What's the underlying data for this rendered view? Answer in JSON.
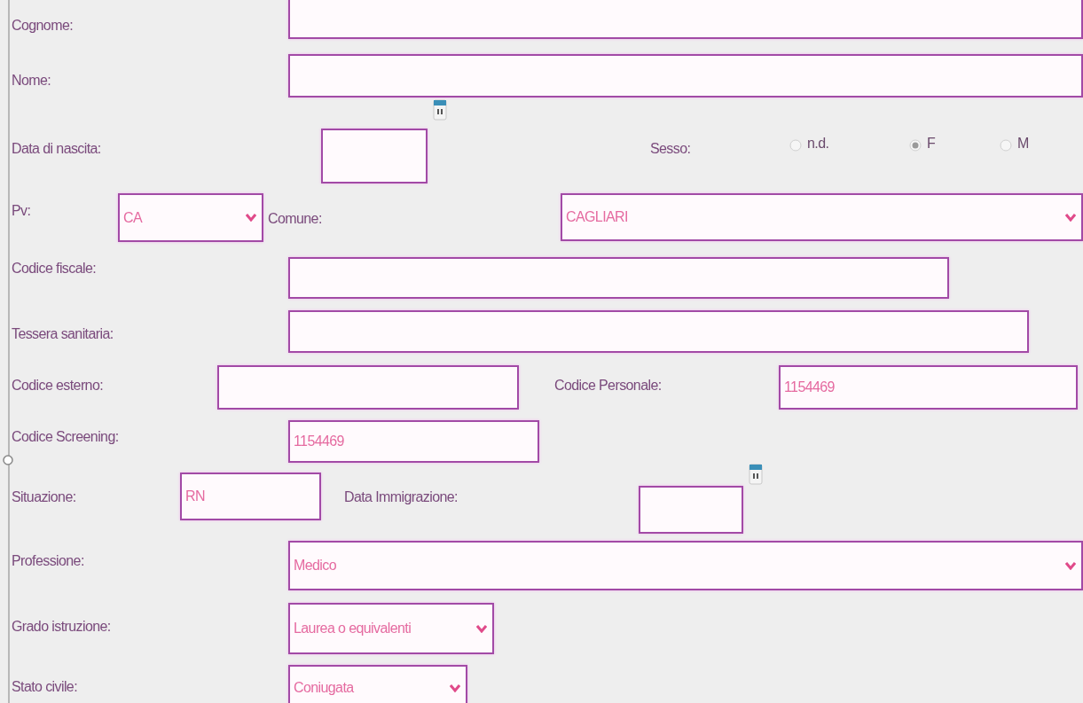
{
  "rows": [
    {
      "items": [
        {
          "kind": "label",
          "text": "Cognome:"
        },
        {
          "kind": "text"
        }
      ]
    },
    {
      "items": [
        {
          "kind": "label",
          "text": "Nome:"
        },
        {
          "kind": "text"
        }
      ]
    },
    {
      "items": [
        {
          "kind": "label",
          "text": "Data di nascita:"
        },
        {
          "kind": "date"
        },
        {
          "kind": "label",
          "text": "Sesso:"
        },
        {
          "kind": "radio",
          "label": "n.d.",
          "selected": false
        },
        {
          "kind": "radio",
          "label": "F",
          "selected": true
        },
        {
          "kind": "radio",
          "label": "M",
          "selected": false
        }
      ]
    },
    {
      "items": [
        {
          "kind": "label",
          "text": "Pv:"
        },
        {
          "kind": "select",
          "value": "CA"
        },
        {
          "kind": "label",
          "text": "Comune:"
        },
        {
          "kind": "select",
          "value": "CAGLIARI"
        }
      ]
    },
    {
      "items": [
        {
          "kind": "label",
          "text": "Codice fiscale:"
        },
        {
          "kind": "text"
        }
      ]
    },
    {
      "items": [
        {
          "kind": "label",
          "text": "Tessera sanitaria:"
        },
        {
          "kind": "text"
        }
      ]
    },
    {
      "items": [
        {
          "kind": "label",
          "text": "Codice esterno:"
        },
        {
          "kind": "text"
        },
        {
          "kind": "label",
          "text": "Codice Personale:"
        },
        {
          "kind": "text",
          "value": "1154469"
        }
      ]
    },
    {
      "items": [
        {
          "kind": "label",
          "text": "Codice Screening:"
        },
        {
          "kind": "text",
          "value": "1154469"
        }
      ]
    },
    {
      "items": [
        {
          "kind": "label",
          "text": "Situazione:"
        },
        {
          "kind": "text",
          "value": "RN"
        },
        {
          "kind": "label",
          "text": "Data Immigrazione:"
        },
        {
          "kind": "date"
        }
      ]
    },
    {
      "items": [
        {
          "kind": "label",
          "text": "Professione:"
        },
        {
          "kind": "select",
          "value": "Medico"
        }
      ]
    },
    {
      "items": [
        {
          "kind": "label",
          "text": "Grado istruzione:"
        },
        {
          "kind": "select",
          "value": "Laurea o equivalenti"
        }
      ]
    },
    {
      "items": [
        {
          "kind": "label",
          "text": "Stato civile:"
        },
        {
          "kind": "select",
          "value": "Coniugata"
        }
      ]
    }
  ]
}
